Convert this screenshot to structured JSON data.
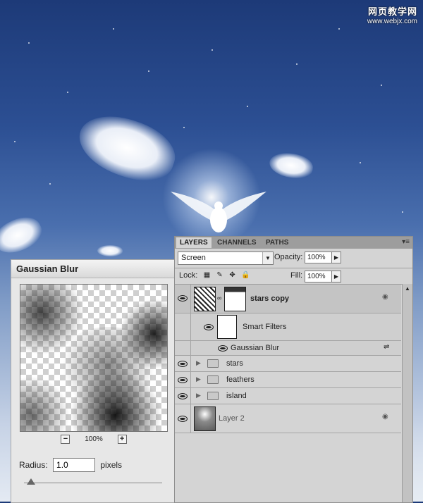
{
  "watermark": {
    "line1": "网页教学网",
    "line2": "www.webjx.com"
  },
  "gaussian_blur": {
    "title": "Gaussian Blur",
    "zoom_out": "−",
    "zoom_level": "100%",
    "zoom_in": "+",
    "radius_label": "Radius:",
    "radius_value": "1.0",
    "radius_unit": "pixels"
  },
  "layers_panel": {
    "tabs": [
      "LAYERS",
      "CHANNELS",
      "PATHS"
    ],
    "menu_icon": "▾≡",
    "blend_mode": "Screen",
    "opacity_label": "Opacity:",
    "opacity_value": "100%",
    "lock_label": "Lock:",
    "fill_label": "Fill:",
    "fill_value": "100%",
    "layers": [
      {
        "name": "stars copy"
      },
      {
        "name": "Smart Filters"
      },
      {
        "name": "Gaussian Blur"
      },
      {
        "name": "stars"
      },
      {
        "name": "feathers"
      },
      {
        "name": "island"
      },
      {
        "name": "Layer 2"
      }
    ]
  },
  "colors": {
    "panel_bg": "#d4d4d4",
    "selected_row": "#c4c4c4",
    "sky_top": "#1d3a78"
  }
}
